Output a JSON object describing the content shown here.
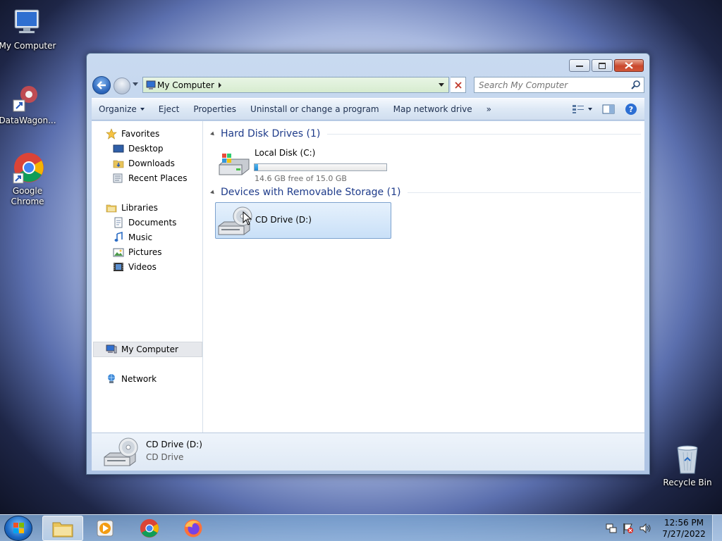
{
  "desktop": {
    "icons": [
      {
        "label": "My Computer"
      },
      {
        "label": "DataWagon..."
      },
      {
        "label": "Google Chrome"
      },
      {
        "label": "Recycle Bin"
      }
    ]
  },
  "window": {
    "address_crumb": "My Computer",
    "search_placeholder": "Search My Computer",
    "toolbar": {
      "organize": "Organize",
      "eject": "Eject",
      "properties": "Properties",
      "uninstall": "Uninstall or change a program",
      "map_drive": "Map network drive",
      "more": "»"
    },
    "nav": {
      "favorites": "Favorites",
      "desktop": "Desktop",
      "downloads": "Downloads",
      "recent": "Recent Places",
      "libraries": "Libraries",
      "documents": "Documents",
      "music": "Music",
      "pictures": "Pictures",
      "videos": "Videos",
      "my_computer": "My Computer",
      "network": "Network"
    },
    "groups": {
      "hdd": "Hard Disk Drives (1)",
      "removable": "Devices with Removable Storage (1)"
    },
    "drives": {
      "c_name": "Local Disk (C:)",
      "c_free": "14.6 GB free of 15.0 GB",
      "c_used_fraction": 0.027,
      "d_name": "CD Drive (D:)"
    },
    "details": {
      "name": "CD Drive (D:)",
      "type": "CD Drive"
    }
  },
  "taskbar": {
    "time": "12:56 PM",
    "date": "7/27/2022"
  }
}
